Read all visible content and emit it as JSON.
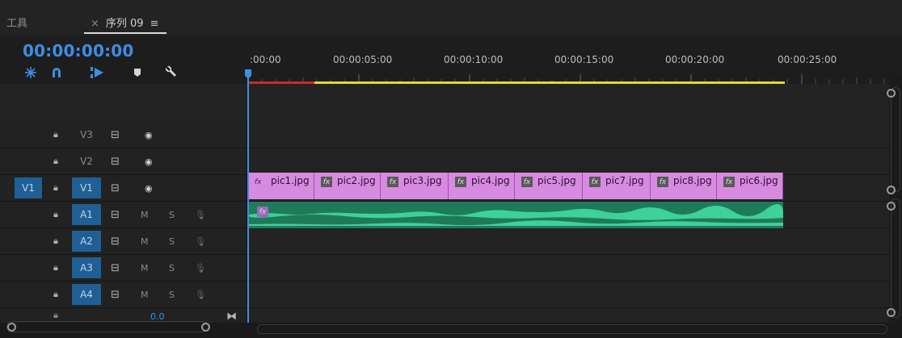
{
  "panel": {
    "tools_tab": "工具",
    "sequence_tab": {
      "close": "×",
      "label": "序列 09",
      "menu": "≡"
    }
  },
  "timecode": "00:00:00:00",
  "toolbar": {
    "icons": [
      "snap-insert-icon",
      "magnet-icon",
      "linked-selection-icon",
      "add-marker-icon",
      "wrench-icon"
    ]
  },
  "ruler": {
    "labels": [
      ":00:00",
      "00:00:05:00",
      "00:00:10:00",
      "00:00:15:00",
      "00:00:20:00",
      "00:00:25:00"
    ]
  },
  "tracks": {
    "video": [
      {
        "target": "V3",
        "source_patch": ""
      },
      {
        "target": "V2",
        "source_patch": ""
      },
      {
        "target": "V1",
        "source_patch": "V1"
      }
    ],
    "audio": [
      {
        "target": "A1",
        "m": "M",
        "s": "S"
      },
      {
        "target": "A2",
        "m": "M",
        "s": "S"
      },
      {
        "target": "A3",
        "m": "M",
        "s": "S"
      },
      {
        "target": "A4",
        "m": "M",
        "s": "S"
      }
    ],
    "master_value": "0.0"
  },
  "clips": [
    {
      "fx": "fx",
      "name": "pic1.jpg"
    },
    {
      "fx": "fx",
      "name": "pic2.jpg"
    },
    {
      "fx": "fx",
      "name": "pic3.jpg"
    },
    {
      "fx": "fx",
      "name": "pic4.jpg"
    },
    {
      "fx": "fx",
      "name": "pic5.jpg"
    },
    {
      "fx": "fx",
      "name": "pic7.jpg"
    },
    {
      "fx": "fx",
      "name": "pic8.jpg"
    },
    {
      "fx": "fx",
      "name": "pic6.jpg"
    }
  ],
  "audio_clip": {
    "fx": "fx"
  },
  "colors": {
    "accent": "#3d8ee6",
    "video_clip": "#d78be0",
    "audio_clip": "#1f7a5a",
    "work_area_red": "#cc2b2b",
    "work_area_yellow": "#e3d92b"
  }
}
